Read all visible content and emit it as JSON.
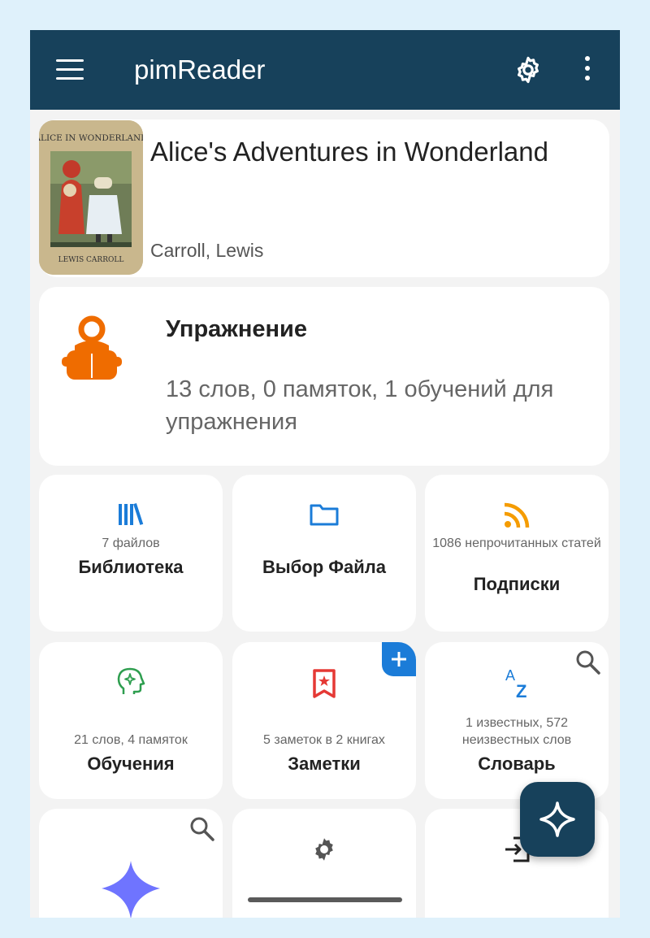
{
  "app": {
    "title": "pimReader",
    "icons": {
      "menu": "hamburger-menu-icon",
      "settings": "gear-icon",
      "more": "more-vert-icon"
    }
  },
  "current_book": {
    "title": "Alice's Adventures in Wonderland",
    "author": "Carroll, Lewis",
    "cover_top_text": "ALICE IN WONDERLAND",
    "cover_bottom_text": "LEWIS CARROLL"
  },
  "exercise": {
    "title": "Упражнение",
    "description": "13 слов, 0 памяток, 1 обучений для упражнения",
    "icon_color": "#ef6c00"
  },
  "tiles": [
    {
      "label": "Библиотека",
      "sub": "7 файлов",
      "icon": "library-books-icon",
      "color": "#1b7cd8"
    },
    {
      "label": "Выбор Файла",
      "sub": "",
      "icon": "folder-icon",
      "color": "#1b7cd8"
    },
    {
      "label": "Подписки",
      "sub": "1086 непрочитанных статей",
      "icon": "rss-feed-icon",
      "color": "#f59c00"
    },
    {
      "label": "Обучения",
      "sub": "21 слов, 4 памяток",
      "icon": "head-sparkle-icon",
      "color": "#2e9e4f"
    },
    {
      "label": "Заметки",
      "sub": "5 заметок в 2 книгах",
      "icon": "bookmark-star-icon",
      "color": "#e53935"
    },
    {
      "label": "Словарь",
      "sub": "1 известных, 572 неизвестных слов",
      "icon": "sort-az-icon",
      "color": "#1b7cd8"
    },
    {
      "label": "",
      "sub": "",
      "icon": "sparkle-icon",
      "color": "#6f74ff"
    },
    {
      "label": "",
      "sub": "",
      "icon": "gear-icon",
      "color": "#555555"
    },
    {
      "label": "",
      "sub": "",
      "icon": "import-icon",
      "color": "#222222"
    }
  ],
  "colors": {
    "appbar": "#17415b",
    "accent": "#1b7cd8",
    "background": "#f3f3f3"
  }
}
